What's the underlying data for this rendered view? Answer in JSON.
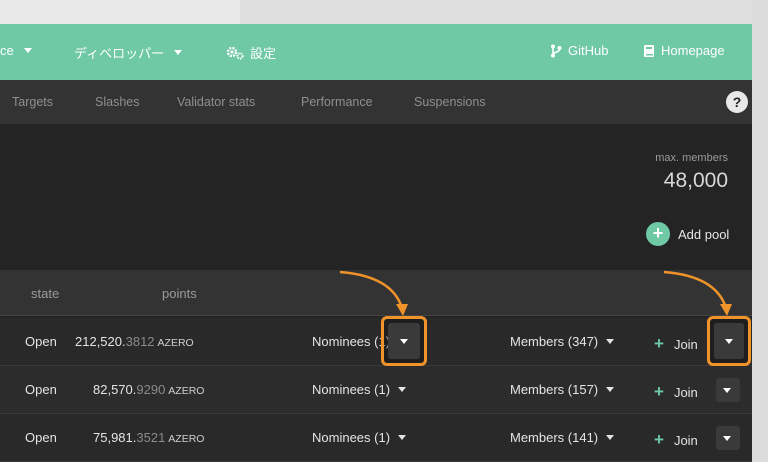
{
  "topbar": {
    "menu_partial": "ce",
    "developer": "ディベロッパー",
    "settings": "設定",
    "github": "GitHub",
    "homepage": "Homepage"
  },
  "subnav": {
    "tabs": [
      "Targets",
      "Slashes",
      "Validator stats",
      "Performance",
      "Suspensions"
    ],
    "help": "?"
  },
  "summary": {
    "max_members_label": "max. members",
    "max_members_value": "48,000",
    "add_pool": "Add pool"
  },
  "table": {
    "headers": {
      "state": "state",
      "points": "points"
    },
    "unit": "AZERO",
    "join_label": "Join",
    "rows": [
      {
        "state": "Open",
        "points_int": "212,520.",
        "points_dec": "3812",
        "nominees": "Nominees (1)",
        "members": "Members (347)"
      },
      {
        "state": "Open",
        "points_int": "82,570.",
        "points_dec": "9290",
        "nominees": "Nominees (1)",
        "members": "Members (157)"
      },
      {
        "state": "Open",
        "points_int": "75,981.",
        "points_dec": "3521",
        "nominees": "Nominees (1)",
        "members": "Members (141)"
      }
    ]
  },
  "colors": {
    "accent": "#6fc9a5",
    "highlight": "#f0932b",
    "background": "#242424"
  },
  "icons": {
    "github": "git-branch-icon",
    "homepage": "book-icon",
    "settings": "gears-icon"
  }
}
